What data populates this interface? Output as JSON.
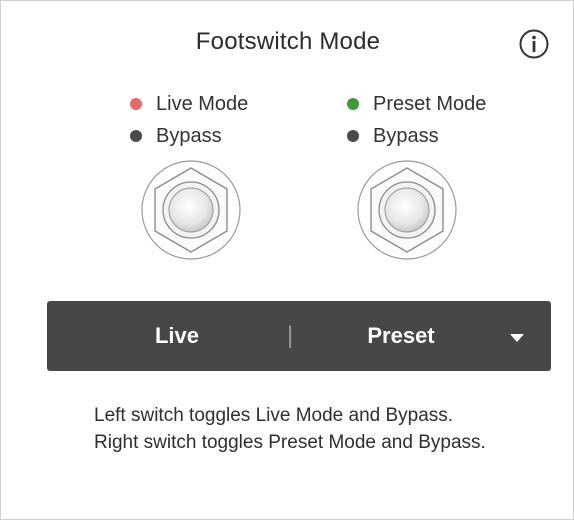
{
  "header": {
    "title": "Footswitch Mode",
    "info_icon": "info-icon"
  },
  "legend": {
    "left": [
      {
        "label": "Live Mode",
        "color": "#e8696b"
      },
      {
        "label": "Bypass",
        "color": "#4a4a4a"
      }
    ],
    "right": [
      {
        "label": "Preset Mode",
        "color": "#3f9a35"
      },
      {
        "label": "Bypass",
        "color": "#4a4a4a"
      }
    ]
  },
  "mode_selector": {
    "left_label": "Live",
    "separator": "|",
    "right_label": "Preset",
    "dropdown_icon": "chevron-down-icon",
    "background": "#474747"
  },
  "description": "Left switch toggles Live Mode and Bypass. Right switch toggles Preset Mode and Bypass."
}
